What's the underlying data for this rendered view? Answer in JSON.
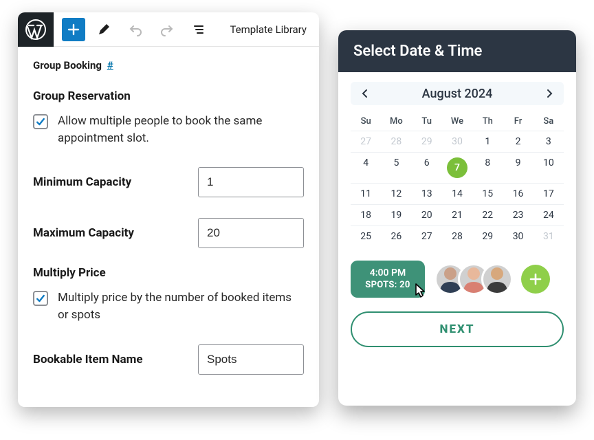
{
  "toolbar": {
    "template_library": "Template Library"
  },
  "breadcrumb": {
    "label": "Group Booking",
    "hash": "#"
  },
  "group_reservation": {
    "title": "Group Reservation",
    "allow_label": "Allow multiple people to book the same appointment slot."
  },
  "min_capacity": {
    "label": "Minimum Capacity",
    "value": "1"
  },
  "max_capacity": {
    "label": "Maximum Capacity",
    "value": "20"
  },
  "multiply_price": {
    "title": "Multiply Price",
    "label": "Multiply price by the number of booked items or spots"
  },
  "bookable_item": {
    "label": "Bookable Item Name",
    "value": "Spots"
  },
  "picker": {
    "title": "Select Date & Time",
    "month": "August 2024",
    "dow": [
      "Su",
      "Mo",
      "Tu",
      "We",
      "Th",
      "Fr",
      "Sa"
    ],
    "weeks": [
      [
        {
          "n": "27",
          "out": true
        },
        {
          "n": "28",
          "out": true
        },
        {
          "n": "29",
          "out": true
        },
        {
          "n": "30",
          "out": true
        },
        {
          "n": "1"
        },
        {
          "n": "2"
        },
        {
          "n": "3"
        }
      ],
      [
        {
          "n": "4"
        },
        {
          "n": "5"
        },
        {
          "n": "6"
        },
        {
          "n": "7",
          "sel": true
        },
        {
          "n": "8"
        },
        {
          "n": "9"
        },
        {
          "n": "10"
        }
      ],
      [
        {
          "n": "11"
        },
        {
          "n": "12"
        },
        {
          "n": "13"
        },
        {
          "n": "14"
        },
        {
          "n": "15"
        },
        {
          "n": "16"
        },
        {
          "n": "17"
        }
      ],
      [
        {
          "n": "18"
        },
        {
          "n": "19"
        },
        {
          "n": "20"
        },
        {
          "n": "21"
        },
        {
          "n": "22"
        },
        {
          "n": "23"
        },
        {
          "n": "24"
        }
      ],
      [
        {
          "n": "25"
        },
        {
          "n": "26"
        },
        {
          "n": "27"
        },
        {
          "n": "28"
        },
        {
          "n": "29"
        },
        {
          "n": "30"
        },
        {
          "n": "31",
          "out": true
        }
      ]
    ],
    "slot": {
      "time": "4:00 PM",
      "spots": "SPOTS: 20"
    },
    "next": "NEXT"
  }
}
